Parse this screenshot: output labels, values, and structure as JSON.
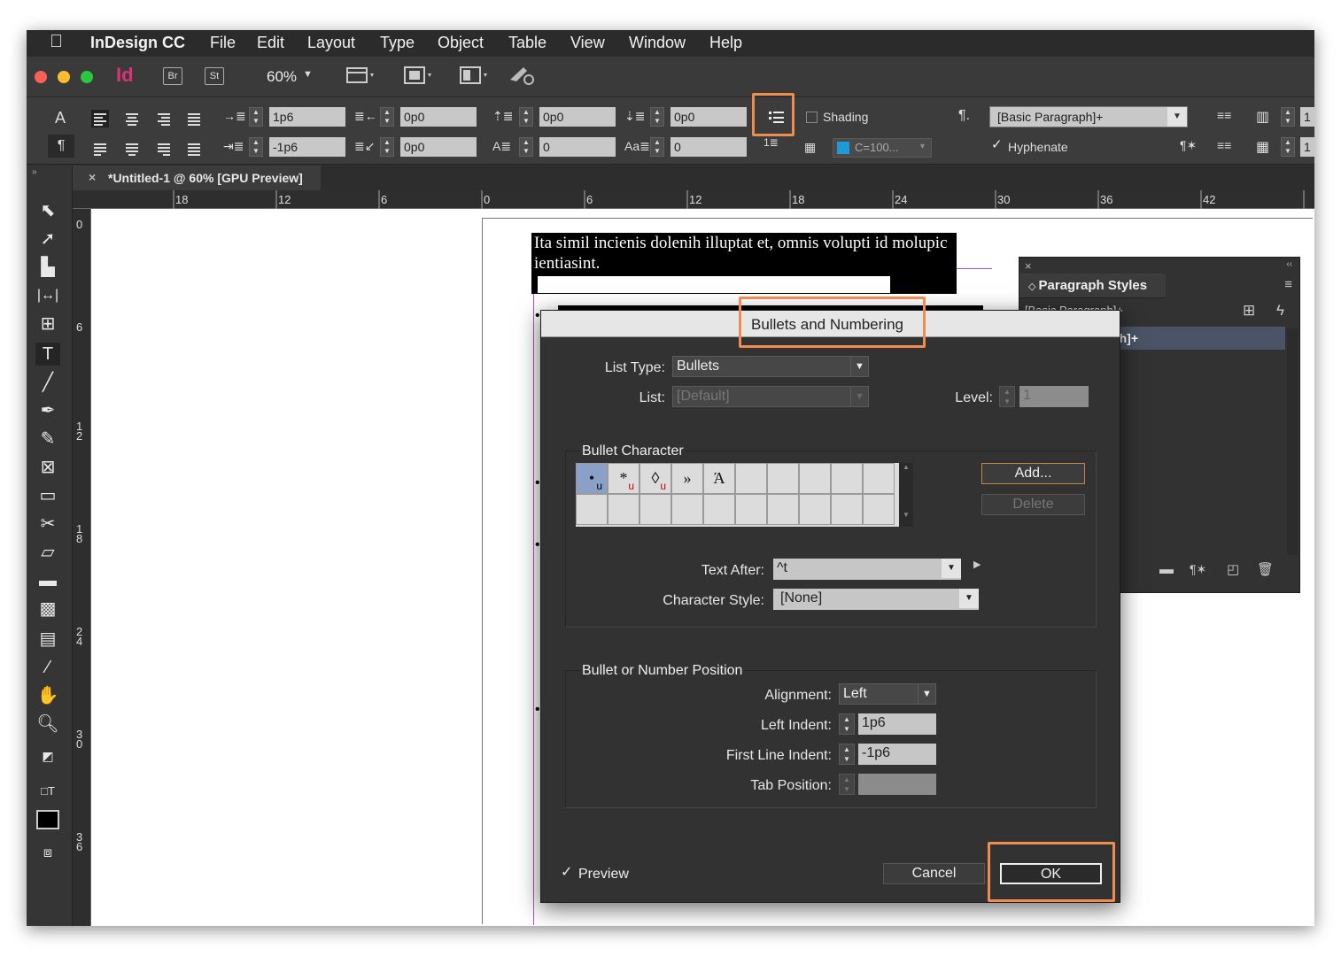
{
  "app": {
    "name": "InDesign CC",
    "menu": [
      "File",
      "Edit",
      "Layout",
      "Type",
      "Object",
      "Table",
      "View",
      "Window",
      "Help"
    ],
    "logo": "Id",
    "bridge": "Br",
    "stock": "St",
    "zoom": "60%"
  },
  "control_bar": {
    "left_indent": "1p6",
    "first_line_indent": "-1p6",
    "right_indent": "0p0",
    "last_line_right_indent": "0p0",
    "space_before": "0p0",
    "space_after": "0p0",
    "dropcap_lines": "0",
    "dropcap_chars": "0",
    "shading_label": "Shading",
    "color_swatch": "C=100...",
    "paragraph_style": "[Basic Paragraph]+",
    "hyphenate_label": "Hyphenate",
    "columns": "1"
  },
  "document": {
    "tab_title": "*Untitled-1 @ 60% [GPU Preview]",
    "ruler_h": [
      "18",
      "12",
      "6",
      "0",
      "6",
      "12",
      "18",
      "24",
      "30",
      "36",
      "42"
    ],
    "ruler_v": [
      "0",
      "6",
      "1\n2",
      "1\n8",
      "2\n4",
      "3\n0",
      "3\n6"
    ],
    "text_line1": "Ita simil incienis dolenih illuptat et, omnis volupti id molupic",
    "text_line2": "ientiasint."
  },
  "paragraph_styles": {
    "title": "Paragraph Styles",
    "current": "[Basic Paragraph]+",
    "selected_item": "[Basic Paragraph]+"
  },
  "dialog": {
    "title": "Bullets and Numbering",
    "list_type_label": "List Type:",
    "list_type": "Bullets",
    "list_label": "List:",
    "list_value": "[Default]",
    "level_label": "Level:",
    "level_value": "1",
    "bullet_char_group": "Bullet Character",
    "bullet_chars": [
      "•",
      "*",
      "◊",
      "»",
      "Ά"
    ],
    "add_button": "Add...",
    "delete_button": "Delete",
    "text_after_label": "Text After:",
    "text_after": "^t",
    "char_style_label": "Character Style:",
    "char_style": "[None]",
    "position_group": "Bullet or Number Position",
    "alignment_label": "Alignment:",
    "alignment": "Left",
    "left_indent_label": "Left Indent:",
    "left_indent": "1p6",
    "first_line_label": "First Line Indent:",
    "first_line": "-1p6",
    "tab_position_label": "Tab Position:",
    "tab_position": "",
    "preview_label": "Preview",
    "cancel_button": "Cancel",
    "ok_button": "OK"
  }
}
